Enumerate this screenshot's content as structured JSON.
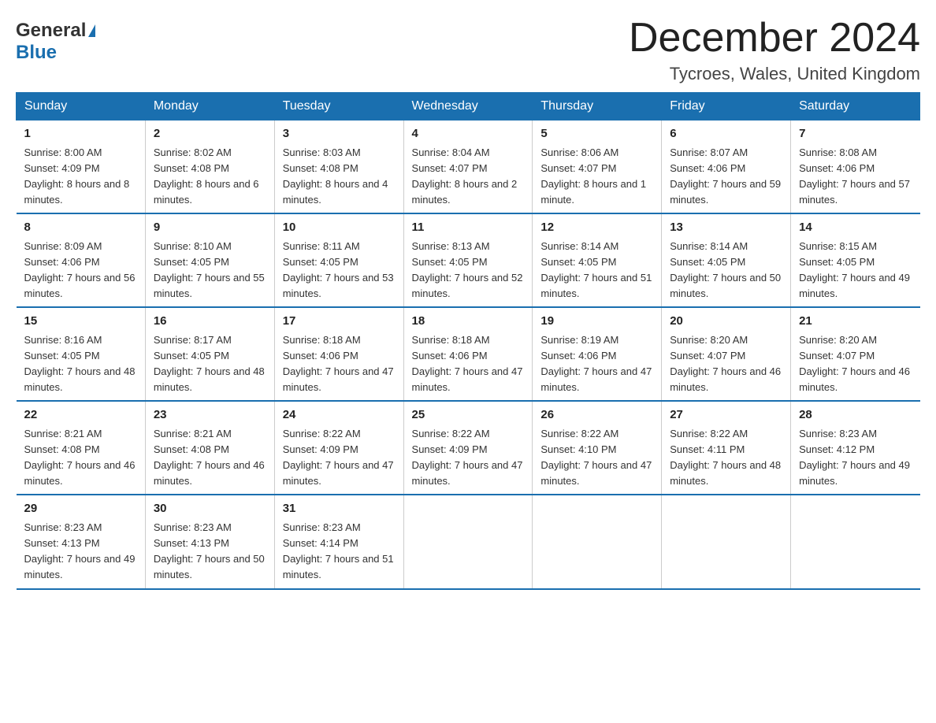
{
  "logo": {
    "general": "General",
    "arrow": "▲",
    "blue": "Blue"
  },
  "title": "December 2024",
  "subtitle": "Tycroes, Wales, United Kingdom",
  "days_of_week": [
    "Sunday",
    "Monday",
    "Tuesday",
    "Wednesday",
    "Thursday",
    "Friday",
    "Saturday"
  ],
  "weeks": [
    [
      {
        "day": "1",
        "sunrise": "8:00 AM",
        "sunset": "4:09 PM",
        "daylight": "8 hours and 8 minutes."
      },
      {
        "day": "2",
        "sunrise": "8:02 AM",
        "sunset": "4:08 PM",
        "daylight": "8 hours and 6 minutes."
      },
      {
        "day": "3",
        "sunrise": "8:03 AM",
        "sunset": "4:08 PM",
        "daylight": "8 hours and 4 minutes."
      },
      {
        "day": "4",
        "sunrise": "8:04 AM",
        "sunset": "4:07 PM",
        "daylight": "8 hours and 2 minutes."
      },
      {
        "day": "5",
        "sunrise": "8:06 AM",
        "sunset": "4:07 PM",
        "daylight": "8 hours and 1 minute."
      },
      {
        "day": "6",
        "sunrise": "8:07 AM",
        "sunset": "4:06 PM",
        "daylight": "7 hours and 59 minutes."
      },
      {
        "day": "7",
        "sunrise": "8:08 AM",
        "sunset": "4:06 PM",
        "daylight": "7 hours and 57 minutes."
      }
    ],
    [
      {
        "day": "8",
        "sunrise": "8:09 AM",
        "sunset": "4:06 PM",
        "daylight": "7 hours and 56 minutes."
      },
      {
        "day": "9",
        "sunrise": "8:10 AM",
        "sunset": "4:05 PM",
        "daylight": "7 hours and 55 minutes."
      },
      {
        "day": "10",
        "sunrise": "8:11 AM",
        "sunset": "4:05 PM",
        "daylight": "7 hours and 53 minutes."
      },
      {
        "day": "11",
        "sunrise": "8:13 AM",
        "sunset": "4:05 PM",
        "daylight": "7 hours and 52 minutes."
      },
      {
        "day": "12",
        "sunrise": "8:14 AM",
        "sunset": "4:05 PM",
        "daylight": "7 hours and 51 minutes."
      },
      {
        "day": "13",
        "sunrise": "8:14 AM",
        "sunset": "4:05 PM",
        "daylight": "7 hours and 50 minutes."
      },
      {
        "day": "14",
        "sunrise": "8:15 AM",
        "sunset": "4:05 PM",
        "daylight": "7 hours and 49 minutes."
      }
    ],
    [
      {
        "day": "15",
        "sunrise": "8:16 AM",
        "sunset": "4:05 PM",
        "daylight": "7 hours and 48 minutes."
      },
      {
        "day": "16",
        "sunrise": "8:17 AM",
        "sunset": "4:05 PM",
        "daylight": "7 hours and 48 minutes."
      },
      {
        "day": "17",
        "sunrise": "8:18 AM",
        "sunset": "4:06 PM",
        "daylight": "7 hours and 47 minutes."
      },
      {
        "day": "18",
        "sunrise": "8:18 AM",
        "sunset": "4:06 PM",
        "daylight": "7 hours and 47 minutes."
      },
      {
        "day": "19",
        "sunrise": "8:19 AM",
        "sunset": "4:06 PM",
        "daylight": "7 hours and 47 minutes."
      },
      {
        "day": "20",
        "sunrise": "8:20 AM",
        "sunset": "4:07 PM",
        "daylight": "7 hours and 46 minutes."
      },
      {
        "day": "21",
        "sunrise": "8:20 AM",
        "sunset": "4:07 PM",
        "daylight": "7 hours and 46 minutes."
      }
    ],
    [
      {
        "day": "22",
        "sunrise": "8:21 AM",
        "sunset": "4:08 PM",
        "daylight": "7 hours and 46 minutes."
      },
      {
        "day": "23",
        "sunrise": "8:21 AM",
        "sunset": "4:08 PM",
        "daylight": "7 hours and 46 minutes."
      },
      {
        "day": "24",
        "sunrise": "8:22 AM",
        "sunset": "4:09 PM",
        "daylight": "7 hours and 47 minutes."
      },
      {
        "day": "25",
        "sunrise": "8:22 AM",
        "sunset": "4:09 PM",
        "daylight": "7 hours and 47 minutes."
      },
      {
        "day": "26",
        "sunrise": "8:22 AM",
        "sunset": "4:10 PM",
        "daylight": "7 hours and 47 minutes."
      },
      {
        "day": "27",
        "sunrise": "8:22 AM",
        "sunset": "4:11 PM",
        "daylight": "7 hours and 48 minutes."
      },
      {
        "day": "28",
        "sunrise": "8:23 AM",
        "sunset": "4:12 PM",
        "daylight": "7 hours and 49 minutes."
      }
    ],
    [
      {
        "day": "29",
        "sunrise": "8:23 AM",
        "sunset": "4:13 PM",
        "daylight": "7 hours and 49 minutes."
      },
      {
        "day": "30",
        "sunrise": "8:23 AM",
        "sunset": "4:13 PM",
        "daylight": "7 hours and 50 minutes."
      },
      {
        "day": "31",
        "sunrise": "8:23 AM",
        "sunset": "4:14 PM",
        "daylight": "7 hours and 51 minutes."
      },
      null,
      null,
      null,
      null
    ]
  ]
}
